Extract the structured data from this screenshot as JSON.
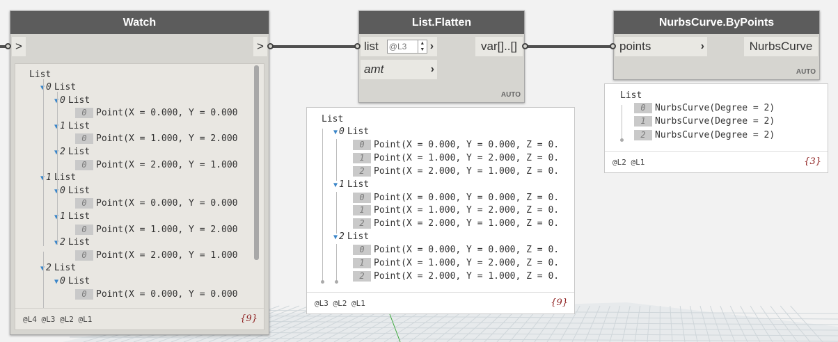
{
  "canvas": {
    "grid_color": "#cfd6da",
    "wire_color": "#505050"
  },
  "watch": {
    "title": "Watch",
    "in_port": ">",
    "out_port": ">",
    "root": "List",
    "rows": [
      {
        "kind": "list",
        "index": "0",
        "label": "List"
      },
      {
        "kind": "list",
        "index": "0",
        "label": "List"
      },
      {
        "kind": "item",
        "index": "0",
        "text": "Point(X = 0.000, Y = 0.000"
      },
      {
        "kind": "list",
        "index": "1",
        "label": "List"
      },
      {
        "kind": "item",
        "index": "0",
        "text": "Point(X = 1.000, Y = 2.000"
      },
      {
        "kind": "list",
        "index": "2",
        "label": "List"
      },
      {
        "kind": "item",
        "index": "0",
        "text": "Point(X = 2.000, Y = 1.000"
      },
      {
        "kind": "list",
        "index": "1",
        "label": "List"
      },
      {
        "kind": "list",
        "index": "0",
        "label": "List"
      },
      {
        "kind": "item",
        "index": "0",
        "text": "Point(X = 0.000, Y = 0.000"
      },
      {
        "kind": "list",
        "index": "1",
        "label": "List"
      },
      {
        "kind": "item",
        "index": "0",
        "text": "Point(X = 1.000, Y = 2.000"
      },
      {
        "kind": "list",
        "index": "2",
        "label": "List"
      },
      {
        "kind": "item",
        "index": "0",
        "text": "Point(X = 2.000, Y = 1.000"
      },
      {
        "kind": "list",
        "index": "2",
        "label": "List"
      },
      {
        "kind": "list",
        "index": "0",
        "label": "List"
      },
      {
        "kind": "item",
        "index": "0",
        "text": "Point(X = 0.000, Y = 0.000"
      }
    ],
    "levels": "@L4 @L3 @L2 @L1",
    "count": "{9}"
  },
  "flatten": {
    "title": "List.Flatten",
    "in1": "list",
    "level_value": "@L3",
    "in2": "amt",
    "out": "var[]..[]",
    "lacing": "AUTO",
    "preview": {
      "root": "List",
      "groups": [
        {
          "index": "0",
          "label": "List",
          "items": [
            "Point(X = 0.000, Y = 0.000, Z = 0.",
            "Point(X = 1.000, Y = 2.000, Z = 0.",
            "Point(X = 2.000, Y = 1.000, Z = 0."
          ]
        },
        {
          "index": "1",
          "label": "List",
          "items": [
            "Point(X = 0.000, Y = 0.000, Z = 0.",
            "Point(X = 1.000, Y = 2.000, Z = 0.",
            "Point(X = 2.000, Y = 1.000, Z = 0."
          ]
        },
        {
          "index": "2",
          "label": "List",
          "items": [
            "Point(X = 0.000, Y = 0.000, Z = 0.",
            "Point(X = 1.000, Y = 2.000, Z = 0.",
            "Point(X = 2.000, Y = 1.000, Z = 0."
          ]
        }
      ],
      "levels": "@L3 @L2 @L1",
      "count": "{9}"
    }
  },
  "nurbs": {
    "title": "NurbsCurve.ByPoints",
    "in1": "points",
    "out": "NurbsCurve",
    "lacing": "AUTO",
    "preview": {
      "root": "List",
      "items": [
        "NurbsCurve(Degree = 2)",
        "NurbsCurve(Degree = 2)",
        "NurbsCurve(Degree = 2)"
      ],
      "levels": "@L2 @L1",
      "count": "{3}"
    }
  }
}
